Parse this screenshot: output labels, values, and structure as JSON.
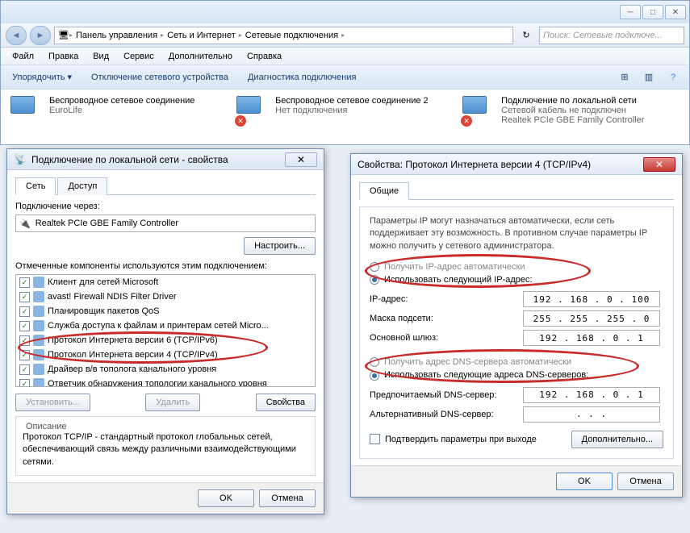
{
  "explorer": {
    "path": [
      "Панель управления",
      "Сеть и Интернет",
      "Сетевые подключения"
    ],
    "search_placeholder": "Поиск: Сетевые подключе...",
    "menu": [
      "Файл",
      "Правка",
      "Вид",
      "Сервис",
      "Дополнительно",
      "Справка"
    ],
    "toolbar": {
      "organize": "Упорядочить",
      "disable": "Отключение сетевого устройства",
      "diagnose": "Диагностика подключения"
    },
    "connections": [
      {
        "title": "Беспроводное сетевое соединение",
        "status": "EuroLife",
        "has_x": false
      },
      {
        "title": "Беспроводное сетевое соединение 2",
        "status": "Нет подключения",
        "has_x": true
      },
      {
        "title": "Подключение по локальной сети",
        "status": "Сетевой кабель не подключен",
        "extra": "Realtek PCIe GBE Family Controller",
        "has_x": true
      }
    ]
  },
  "propdlg": {
    "title": "Подключение по локальной сети - свойства",
    "tabs": [
      "Сеть",
      "Доступ"
    ],
    "connect_via_label": "Подключение через:",
    "adapter": "Realtek PCIe GBE Family Controller",
    "configure": "Настроить...",
    "components_label": "Отмеченные компоненты используются этим подключением:",
    "components": [
      "Клиент для сетей Microsoft",
      "avast! Firewall NDIS Filter Driver",
      "Планировщик пакетов QoS",
      "Служба доступа к файлам и принтерам сетей Micro...",
      "Протокол Интернета версии 6 (TCP/IPv6)",
      "Протокол Интернета версии 4 (TCP/IPv4)",
      "Драйвер в/в тополога канального уровня",
      "Ответчик обнаружения топологии канального уровня"
    ],
    "install": "Установить...",
    "uninstall": "Удалить",
    "properties": "Свойства",
    "desc_title": "Описание",
    "desc_text": "Протокол TCP/IP - стандартный протокол глобальных сетей, обеспечивающий связь между различными взаимодействующими сетями.",
    "ok": "OK",
    "cancel": "Отмена"
  },
  "ipdlg": {
    "title": "Свойства: Протокол Интернета версии 4 (TCP/IPv4)",
    "tab": "Общие",
    "intro": "Параметры IP могут назначаться автоматически, если сеть поддерживает эту возможность. В противном случае параметры IP можно получить у сетевого администратора.",
    "r1": "Получить IP-адрес автоматически",
    "r2": "Использовать следующий IP-адрес:",
    "ip_label": "IP-адрес:",
    "ip": "192 . 168 .  0  . 100",
    "mask_label": "Маска подсети:",
    "mask": "255 . 255 . 255 .  0",
    "gw_label": "Основной шлюз:",
    "gw": "192 . 168 .  0  .  1",
    "r3": "Получить адрес DNS-сервера автоматически",
    "r4": "Использовать следующие адреса DNS-серверов:",
    "dns1_label": "Предпочитаемый DNS-сервер:",
    "dns1": "192 . 168 .  0  .  1",
    "dns2_label": "Альтернативный DNS-сервер:",
    "dns2": "  .    .    .  ",
    "confirm": "Подтвердить параметры при выходе",
    "advanced": "Дополнительно...",
    "ok": "OK",
    "cancel": "Отмена"
  }
}
